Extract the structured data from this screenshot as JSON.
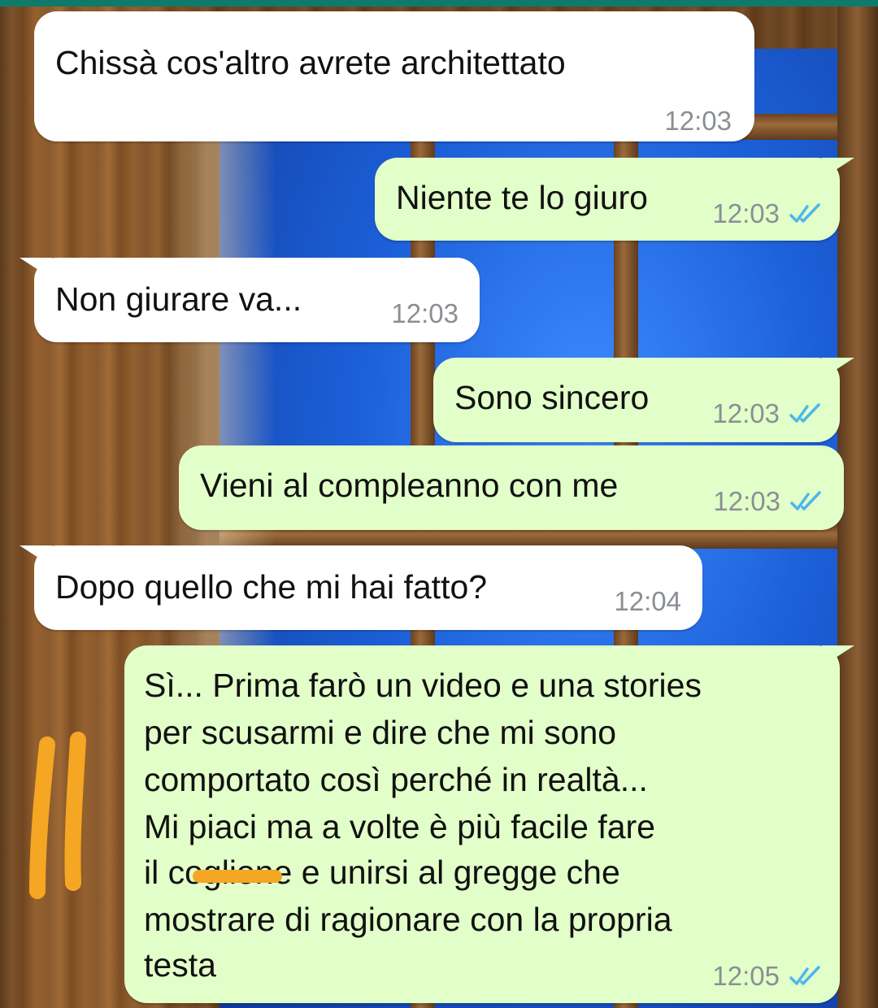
{
  "messages": [
    {
      "direction": "in",
      "text": "Chissà cos'altro avrete architettato",
      "time": "12:03",
      "read": false
    },
    {
      "direction": "out",
      "text": "Niente te lo giuro",
      "time": "12:03",
      "read": true
    },
    {
      "direction": "in",
      "text": "Non giurare va...",
      "time": "12:03",
      "read": false
    },
    {
      "direction": "out",
      "text": "Sono sincero",
      "time": "12:03",
      "read": true
    },
    {
      "direction": "out",
      "text": "Vieni al compleanno con me",
      "time": "12:03",
      "read": true
    },
    {
      "direction": "in",
      "text": "Dopo quello che mi hai fatto?",
      "time": "12:04",
      "read": false
    },
    {
      "direction": "out",
      "lines": [
        "Sì... Prima farò un video e una stories",
        "per scusarmi e dire che mi sono",
        "comportato così perché in realtà...",
        "Mi piaci ma a volte è più facile fare",
        "il coglione e unirsi al gregge che",
        "mostrare di ragionare con la propria",
        "testa"
      ],
      "time": "12:05",
      "read": true
    }
  ],
  "colors": {
    "incoming_bubble": "#ffffff",
    "outgoing_bubble": "#e2ffc9",
    "read_ticks": "#4fb6ec",
    "timestamp": "#8a8f94",
    "annotation": "#f5a623"
  },
  "icons": {
    "read_receipt": "double-check-icon"
  }
}
